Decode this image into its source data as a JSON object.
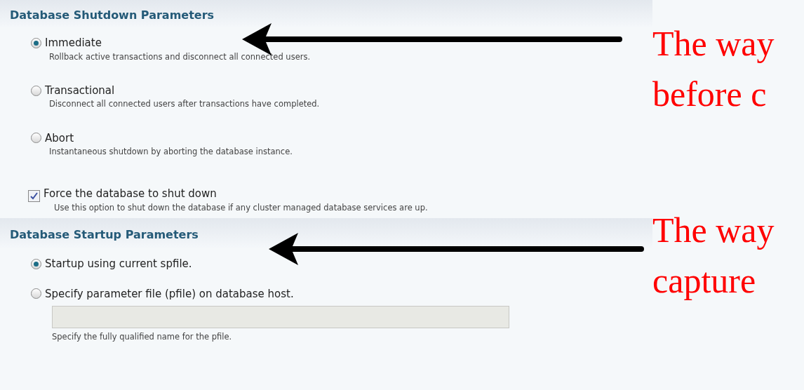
{
  "shutdown": {
    "title": "Database Shutdown Parameters",
    "options": [
      {
        "label": "Immediate",
        "description": "Rollback active transactions and disconnect all connected users.",
        "selected": true
      },
      {
        "label": "Transactional",
        "description": "Disconnect all connected users after transactions have completed.",
        "selected": false
      },
      {
        "label": "Abort",
        "description": "Instantaneous shutdown by aborting the database instance.",
        "selected": false
      }
    ],
    "force": {
      "label": "Force the database to shut down",
      "description": "Use this option to shut down the database if any cluster managed database services are up.",
      "checked": true
    }
  },
  "startup": {
    "title": "Database Startup Parameters",
    "options": [
      {
        "label": "Startup using current spfile.",
        "selected": true
      },
      {
        "label": "Specify parameter file (pfile) on database host.",
        "selected": false
      }
    ],
    "pfile": {
      "hint": "Specify the fully qualified name for the pfile."
    }
  },
  "annotations": [
    {
      "lines": [
        "The way",
        "before c"
      ]
    },
    {
      "lines": [
        "The way",
        "capture"
      ]
    }
  ]
}
